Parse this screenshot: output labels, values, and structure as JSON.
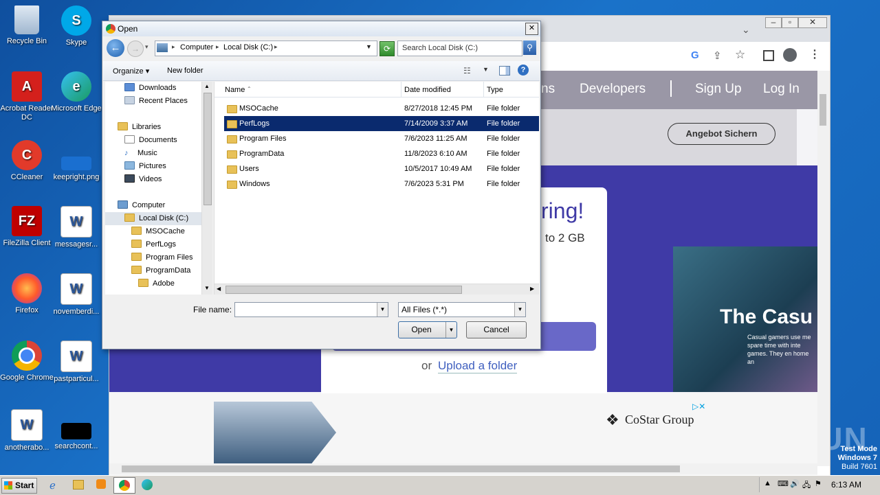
{
  "desktop": {
    "icons": [
      {
        "label": "Recycle Bin"
      },
      {
        "label": "Skype"
      },
      {
        "label": "Acrobat Reader DC"
      },
      {
        "label": "Microsoft Edge"
      },
      {
        "label": "CCleaner"
      },
      {
        "label": "keepright.png"
      },
      {
        "label": "FileZilla Client"
      },
      {
        "label": "messagesr..."
      },
      {
        "label": "Firefox"
      },
      {
        "label": "novemberdi..."
      },
      {
        "label": "Google Chrome"
      },
      {
        "label": "pastparticul..."
      },
      {
        "label": "anotherabo..."
      },
      {
        "label": "searchcont..."
      }
    ],
    "watermark": "ANY RUN",
    "test_mode": {
      "line1": "Test Mode",
      "line2": "Windows 7",
      "line3": "Build 7601"
    }
  },
  "browser": {
    "nav": {
      "item_partial": "ns",
      "developers": "Developers",
      "sign_up": "Sign Up",
      "log_in": "Log In"
    },
    "cta_button": "Angebot Sichern",
    "hero_title_partial": "ring!",
    "hero_sub_partial": "to 2 GB",
    "upload_or": "or",
    "upload_folder": "Upload a folder",
    "promo_text_big": "The Casu",
    "promo_text_small": "Casual gamers use me spare time with inte games. They en home an",
    "ad_brand": "CoStar Group"
  },
  "dialog": {
    "title": "Open",
    "breadcrumb": [
      "Computer",
      "Local Disk (C:)"
    ],
    "search_placeholder": "Search Local Disk (C:)",
    "toolbar": {
      "organize": "Organize",
      "new_folder": "New folder"
    },
    "tree": [
      {
        "label": "Downloads",
        "level": 1
      },
      {
        "label": "Recent Places",
        "level": 1
      },
      {
        "label": "Libraries",
        "level": 0
      },
      {
        "label": "Documents",
        "level": 1
      },
      {
        "label": "Music",
        "level": 1
      },
      {
        "label": "Pictures",
        "level": 1
      },
      {
        "label": "Videos",
        "level": 1
      },
      {
        "label": "Computer",
        "level": 0
      },
      {
        "label": "Local Disk (C:)",
        "level": 1
      },
      {
        "label": "MSOCache",
        "level": 2
      },
      {
        "label": "PerfLogs",
        "level": 2
      },
      {
        "label": "Program Files",
        "level": 2
      },
      {
        "label": "ProgramData",
        "level": 2
      },
      {
        "label": "Adobe",
        "level": 3
      }
    ],
    "columns": {
      "name": "Name",
      "date": "Date modified",
      "type": "Type"
    },
    "files": [
      {
        "name": "MSOCache",
        "date": "8/27/2018 12:45 PM",
        "type": "File folder"
      },
      {
        "name": "PerfLogs",
        "date": "7/14/2009 3:37 AM",
        "type": "File folder"
      },
      {
        "name": "Program Files",
        "date": "7/6/2023 11:25 AM",
        "type": "File folder"
      },
      {
        "name": "ProgramData",
        "date": "11/8/2023 6:10 AM",
        "type": "File folder"
      },
      {
        "name": "Users",
        "date": "10/5/2017 10:49 AM",
        "type": "File folder"
      },
      {
        "name": "Windows",
        "date": "7/6/2023 5:31 PM",
        "type": "File folder"
      }
    ],
    "file_name_label": "File name:",
    "file_name_value": "",
    "filter": "All Files (*.*)",
    "open_button": "Open",
    "cancel_button": "Cancel"
  },
  "taskbar": {
    "start": "Start",
    "clock": "6:13 AM"
  }
}
